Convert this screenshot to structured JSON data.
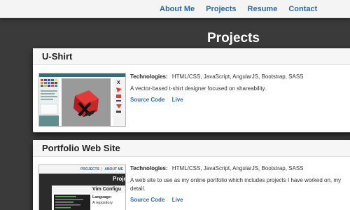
{
  "nav": {
    "items": [
      "About Me",
      "Projects",
      "Resume",
      "Contact"
    ]
  },
  "page": {
    "title": "Projects"
  },
  "projects": [
    {
      "title": "U-Shirt",
      "tech_label": "Technologies:",
      "technologies": "HTML/CSS, JavaScript, AngularJS, Bootstrap, SASS",
      "description": "A vector-based t-shirt designer focused on shareability.",
      "links": [
        "Source Code",
        "Live"
      ]
    },
    {
      "title": "Portfolio Web Site",
      "tech_label": "Technologies:",
      "technologies": "HTML/CSS, JavaScript, AngularJS, Bootstrap, SASS",
      "description": "A web site to use as my online portfolio which includes projects I have worked on, my detail.",
      "links": [
        "Source Code",
        "Live"
      ],
      "thumb": {
        "nav": [
          "PROJECTS",
          "ABOUT ME"
        ],
        "heading": "Proje",
        "subheading": "Vim Configu",
        "language_label": "Language:",
        "desc": "A repository"
      }
    }
  ],
  "colors": {
    "link": "#2a6aa7",
    "background": "#3a3a3a",
    "accent_red": "#d9241c"
  }
}
